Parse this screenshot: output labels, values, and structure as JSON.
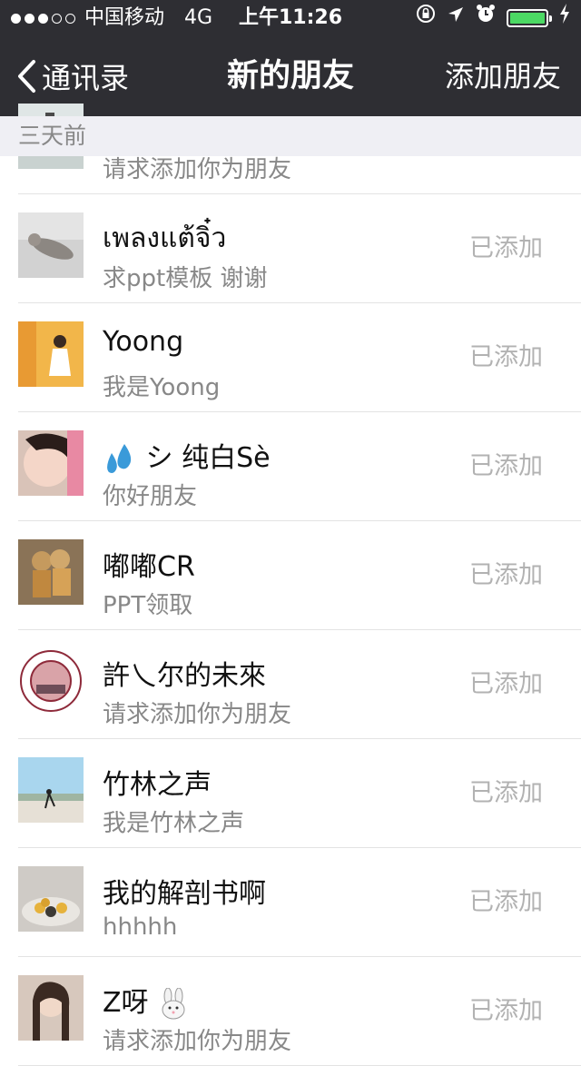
{
  "status_bar": {
    "carrier": "中国移动",
    "network": "4G",
    "time": "上午11:26",
    "signal_bars_filled": 3,
    "signal_bars_total": 5,
    "battery_level": 1.0,
    "battery_color": "#4cd964",
    "icons": [
      "orientation-lock-icon",
      "location-arrow-icon",
      "alarm-clock-icon",
      "battery-icon",
      "charging-bolt-icon"
    ]
  },
  "nav": {
    "back_label": "通讯录",
    "title": "新的朋友",
    "add_label": "添加朋友"
  },
  "section": {
    "title": "三天前"
  },
  "friends": [
    {
      "name": "",
      "message": "请求添加你为朋友",
      "status": ""
    },
    {
      "name": "เพลงแต้จิ๋ว",
      "message": "求ppt模板  谢谢",
      "status": "已添加"
    },
    {
      "name": "Yoong",
      "message": "我是Yoong",
      "status": "已添加"
    },
    {
      "name": "シ 纯白Sè",
      "name_emoji": "sweat-droplets-icon",
      "message": "你好朋友",
      "status": "已添加"
    },
    {
      "name": "嘟嘟CR",
      "message": "PPT领取",
      "status": "已添加"
    },
    {
      "name": "許乀尔的未來",
      "message": "请求添加你为朋友",
      "status": "已添加"
    },
    {
      "name": "竹林之声",
      "message": "我是竹林之声",
      "status": "已添加"
    },
    {
      "name": "我的解剖书啊",
      "message": "hhhhh",
      "status": "已添加"
    },
    {
      "name": "Z呀",
      "name_emoji": "rabbit-face-icon",
      "message": "请求添加你为朋友",
      "status": "已添加"
    }
  ],
  "colors": {
    "nav_background": "#2e2e33",
    "section_background": "#efeff4",
    "status_text": "#b2b2b2"
  }
}
